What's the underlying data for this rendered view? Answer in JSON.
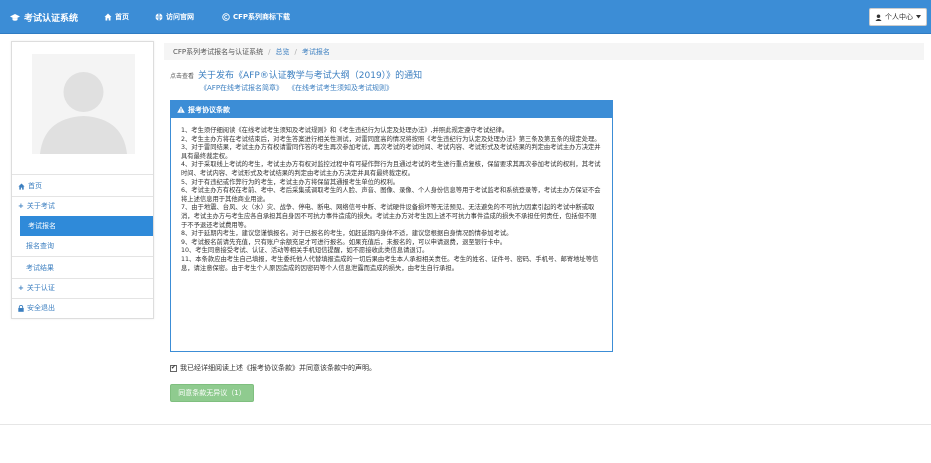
{
  "navbar": {
    "brand": "考试认证系统",
    "links": [
      {
        "label": "首页",
        "icon": "home-icon"
      },
      {
        "label": "访问官网",
        "icon": "globe-icon"
      },
      {
        "label": "CFP系列商标下载",
        "icon": "copyright-icon"
      }
    ],
    "user_menu": "个人中心"
  },
  "sidebar": {
    "home": "首页",
    "about_exam": "关于考试",
    "exam_signup": "考试报名",
    "signup_query": "报名查询",
    "exam_results": "考试结果",
    "about_cert": "关于认证",
    "logout": "安全退出"
  },
  "breadcrumb": {
    "root": "CFP系列考试报名与认证系统",
    "home": "总览",
    "current": "考试报名",
    "sep": "/"
  },
  "notice": {
    "prefix": "点击查看",
    "link": "关于发布《AFP®认证教学与考试大纲（2019）》的通知",
    "sub1": "《AFP在线考试报名简章》",
    "sub2": "《在线考试考生须知及考试规则》"
  },
  "panel": {
    "title": "报考协议条款",
    "paragraphs": [
      "1、考生须仔细阅读《在线考试考生须知及考试规则》和《考生违纪行为认定及处理办法》,并照此规定遵守考试纪律。",
      "2、考生主办方将在考试结束后，对考生答案进行相关性测试，对雷同度高的情况将按照《考生违纪行为认定及处理办法》第三条及第五条的规定处理。",
      "3、对于雷同结果，考试主办方有权请雷同作答的考生再次参加考试，再次考试的考试时间、考试内容、考试形式及考试结果的判定由考试主办方决定并具有最终裁定权。",
      "4、对于采取线上考试的考生，考试主办方有权对监控过程中有可疑作弊行为且通过考试的考生进行重点复核，保留要求其再次参加考试的权利，其考试时间、考试内容、考试形式及考试结果的判定由考试主办方决定并具有最终裁定权。",
      "5、对于有违纪或作弊行为的考生，考试主办方将保留其通报考生单位的权利。",
      "6、考试主办方有权在考前、考中、考后采集或调取考生的人脸、声音、图像、录像、个人身份信息等用于考试监考和系统登录等，考试主办方保证不会将上述信息用于其他商业用途。",
      "7、由于地震、台风、火（水）灾、战争、停电、断电、网络信号中断、考试硬件设备损坏等无法预见、无法避免的不可抗力因素引起的考试中断或取消，考试主办方与考生应各自承担其自身因不可抗力事件造成的损失。考试主办方对考生因上述不可抗力事件造成的损失不承担任何责任，包括但不限于不予退还考试费用等。",
      "8、对于延期内考生，建议您谨慎报名。对于已报名的考生，如赶延期内身体不适，建议您根据自身情况酌情参加考试。",
      "9、考试报名前请先充值，只有账户余额充足才可进行报名。如果充值后，未报名的，可以申请退费，退至银行卡中。",
      "10、考生同意接受考试、认证、活动等相关手机短信提醒，如不愿接收此类信息请退订。",
      "11、本条款应由考生自己填报，考生委托他人代替填报造成的一切后果由考生本人承担相关责任。考生的姓名、证件号、密码、手机号、邮寄地址等信息，请注意保密。由于考生个人原因造成的因密码等个人信息泄露而造成的损失，由考生自行承担。"
    ]
  },
  "agreement": {
    "text": "我已经详细阅读上述《报考协议条款》并同意该条款中的声明。"
  },
  "submit_label": "同意条款无异议（1）",
  "colors": {
    "primary": "#3c8dd6",
    "active": "#2f8ad9",
    "button_disabled": "#8fcb8f"
  }
}
